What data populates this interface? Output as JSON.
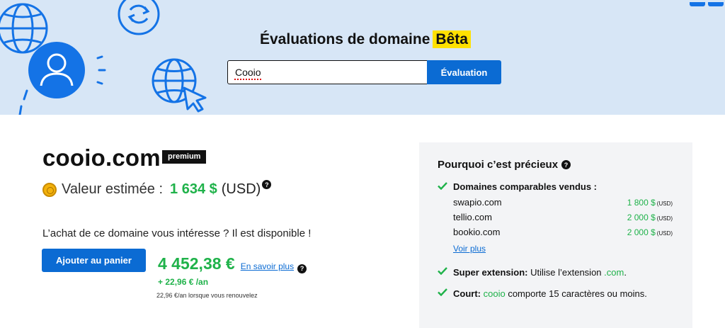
{
  "header": {
    "title": "Évaluations de domaine",
    "beta_badge": "Bêta",
    "search_value": "Cooio",
    "search_button": "Évaluation"
  },
  "domain": {
    "name": "cooio.com",
    "badge": "premium",
    "valuation_label": "Valeur estimée :",
    "valuation_amount": "1 634 $",
    "valuation_currency": "(USD)",
    "help_glyph": "?",
    "availability_text": "L’achat de ce domaine vous intéresse ? Il est disponible !",
    "add_to_cart": "Ajouter au panier",
    "price": "4 452,38 €",
    "learn_more": "En savoir plus",
    "per_year": "+ 22,96 € /an",
    "renew_note": "22,96 €/an lorsque vous renouvelez"
  },
  "panel": {
    "title": "Pourquoi c’est précieux",
    "comparable_label": "Domaines comparables vendus :",
    "comparables": [
      {
        "name": "swapio.com",
        "price": "1 800 $",
        "currency": "(USD)"
      },
      {
        "name": "tellio.com",
        "price": "2 000 $",
        "currency": "(USD)"
      },
      {
        "name": "bookio.com",
        "price": "2 000 $",
        "currency": "(USD)"
      }
    ],
    "see_more": "Voir plus",
    "extension_label": "Super extension:",
    "extension_text_before": "Utilise l’extension",
    "extension_value": ".com",
    "extension_text_after": ".",
    "short_label": "Court:",
    "short_value": "cooio",
    "short_text": "comporte 15 caractères ou moins."
  },
  "icons": [
    "globe-icon",
    "user-icon",
    "refresh-icon",
    "cursor-icon",
    "help-icon",
    "check-icon",
    "coin-icon"
  ],
  "colors": {
    "hero_bg": "#d7e6f6",
    "accent_blue": "#0b6bd3",
    "price_green": "#1fb24a",
    "beta_yellow": "#ffe100",
    "icon_blue": "#1473e6",
    "panel_bg": "#f3f4f6"
  }
}
